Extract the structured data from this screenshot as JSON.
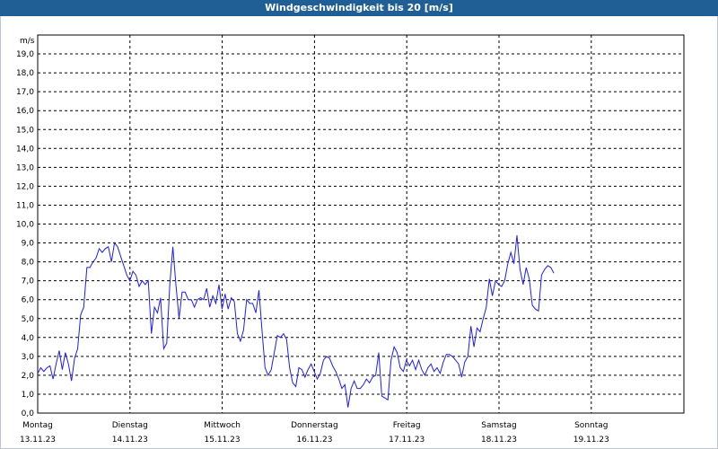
{
  "window": {
    "title": "Windgeschwindigkeit bis 20 [m/s]"
  },
  "chart_data": {
    "type": "line",
    "title": "Windgeschwindigkeit bis 20 [m/s]",
    "ylabel": "m/s",
    "ylim": [
      0,
      20
    ],
    "y_ticks": [
      "0,0",
      "1,0",
      "2,0",
      "3,0",
      "4,0",
      "5,0",
      "6,0",
      "7,0",
      "8,0",
      "9,0",
      "10,0",
      "11,0",
      "12,0",
      "13,0",
      "14,0",
      "15,0",
      "16,0",
      "17,0",
      "18,0",
      "19,0"
    ],
    "x_ticks": [
      {
        "day": "Montag",
        "date": "13.11.23"
      },
      {
        "day": "Dienstag",
        "date": "14.11.23"
      },
      {
        "day": "Mittwoch",
        "date": "15.11.23"
      },
      {
        "day": "Donnerstag",
        "date": "16.11.23"
      },
      {
        "day": "Freitag",
        "date": "17.11.23"
      },
      {
        "day": "Samstag",
        "date": "18.11.23"
      },
      {
        "day": "Sonntag",
        "date": "19.11.23"
      }
    ],
    "grid": true,
    "line_color": "#1c1cff",
    "series": [
      {
        "name": "",
        "days_per_value": 0.0333,
        "values": [
          2.1,
          2.4,
          2.2,
          2.4,
          2.5,
          1.8,
          2.6,
          3.3,
          2.3,
          3.2,
          2.6,
          1.7,
          2.9,
          3.4,
          5.2,
          5.6,
          7.7,
          7.7,
          8.0,
          8.2,
          8.7,
          8.5,
          8.7,
          8.8,
          8.0,
          9.0,
          8.8,
          8.3,
          7.8,
          7.3,
          7.0,
          7.5,
          7.3,
          6.7,
          7.0,
          6.8,
          7.0,
          4.2,
          5.6,
          5.3,
          6.1,
          3.4,
          3.7,
          6.8,
          8.8,
          6.8,
          5.0,
          6.4,
          6.4,
          6.0,
          6.0,
          5.6,
          6.0,
          6.1,
          6.0,
          6.6,
          5.6,
          6.2,
          5.8,
          6.8,
          5.5,
          6.3,
          5.5,
          6.1,
          5.9,
          4.2,
          3.8,
          4.4,
          6.0,
          5.8,
          5.8,
          5.3,
          6.5,
          4.4,
          2.4,
          2.0,
          2.3,
          3.2,
          4.1,
          4.0,
          4.2,
          3.9,
          2.4,
          1.6,
          1.4,
          2.4,
          2.3,
          1.9,
          2.3,
          2.6,
          2.2,
          1.8,
          2.1,
          2.8,
          3.0,
          2.9,
          2.5,
          2.2,
          1.8,
          1.3,
          1.5,
          0.3,
          1.3,
          1.7,
          1.3,
          1.3,
          1.5,
          1.8,
          1.6,
          1.9,
          2.0,
          3.2,
          0.9,
          0.8,
          0.7,
          2.8,
          3.5,
          3.2,
          2.4,
          2.2,
          2.8,
          2.5,
          2.8,
          2.3,
          2.8,
          2.3,
          2.0,
          2.4,
          2.6,
          2.2,
          2.4,
          2.1,
          2.7,
          3.1,
          3.1,
          3.0,
          2.8,
          2.6,
          1.9,
          2.7,
          3.0,
          4.6,
          3.5,
          4.5,
          4.3,
          5.0,
          5.6,
          7.1,
          6.2,
          7.0,
          6.8,
          6.7,
          7.0,
          7.9,
          8.5,
          7.9,
          9.4,
          7.6,
          6.8,
          7.7,
          7.1,
          5.7,
          5.5,
          5.4,
          7.3,
          7.6,
          7.8,
          7.7,
          7.4
        ]
      }
    ]
  }
}
